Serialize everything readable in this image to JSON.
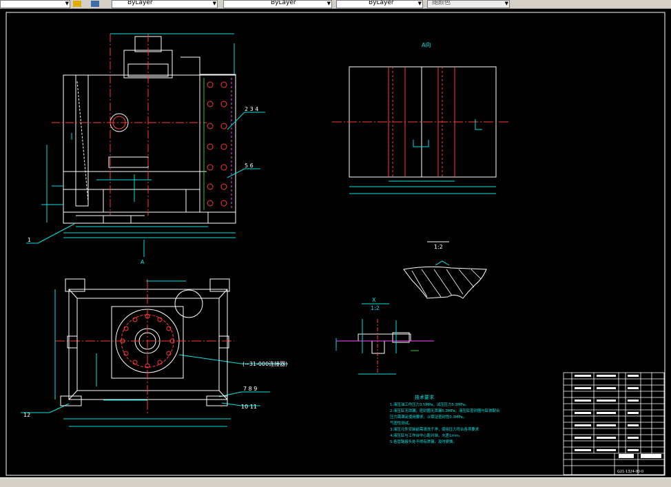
{
  "toolbar": {
    "linetype_label": "ByLayer",
    "color_label": "ByLayer",
    "lineweight_label": "ByLayer",
    "plotstyle_label": "随颜色",
    "colors": {
      "bg": "#d4d0c8",
      "canvas": "#000000"
    }
  },
  "drawing": {
    "view_a_label": "A向",
    "view_a_arrow_label": "A",
    "scale_label": "1:2",
    "x_detail_label": "X",
    "x_detail_scale": "1:2",
    "balloon_234": "2  3  4",
    "balloon_56": "5  6",
    "balloon_1": "1",
    "balloon_789": "7  8  9",
    "balloon_1011": "10  11",
    "balloon_12": "12",
    "connector_label": "(~31-000连接器)",
    "notes": {
      "title": "技术要求",
      "lines": [
        "1.液压油工作压力3.5MPa，试压压力5.3MPa。",
        "2.液压缸无泄漏，密封圈无泄漏5.3MPa，液压缸密封圈与缸体配合",
        "压力需满足使用要求，以保证密封性0.3MPa。",
        "气密性测试。",
        "3.液压元件安装前需清洗干净，使用压力符合各项要求",
        "4.液压缸与工作台中心距对准，允差1mm。",
        "5.各管路接头处不得有渗漏，及时更换。"
      ]
    },
    "title_block_number": "G21-1324-00-0",
    "colors": {
      "cyan": "#00e5e5",
      "white": "#ffffff",
      "red": "#ff3b3b",
      "green": "#27d427",
      "magenta": "#ff4dff",
      "yellow": "#ffff40"
    }
  }
}
